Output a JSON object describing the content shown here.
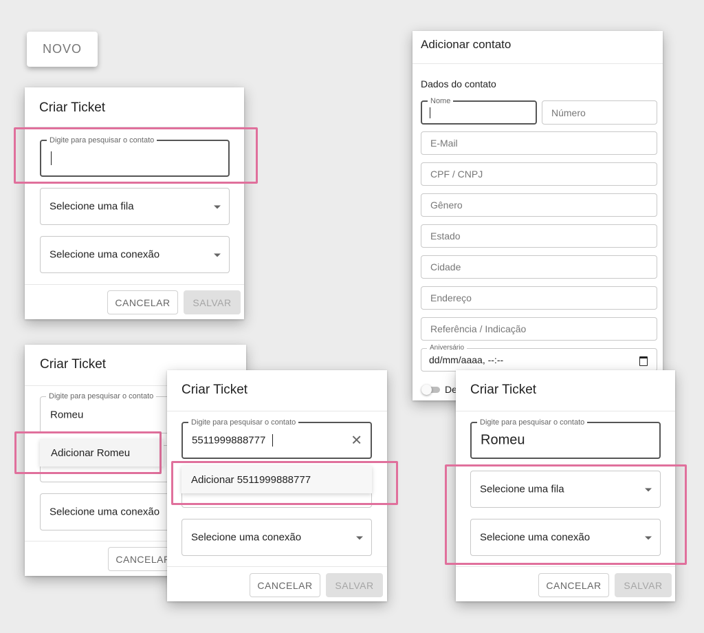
{
  "novo_button": "NOVO",
  "add_contact": {
    "title": "Adicionar contato",
    "section": "Dados do contato",
    "nome_label": "Nome",
    "numero": "Número",
    "email": "E-Mail",
    "cpf": "CPF / CNPJ",
    "genero": "Gênero",
    "estado": "Estado",
    "cidade": "Cidade",
    "endereco": "Endereço",
    "referencia": "Referência / Indicação",
    "aniversario_label": "Aniversário",
    "aniversario_value": "dd/mm/aaaa, --:--",
    "toggle_label": "De"
  },
  "ticket": {
    "title": "Criar Ticket",
    "search_label": "Digite para pesquisar o contato",
    "queue_placeholder": "Selecione uma fila",
    "connection_placeholder": "Selecione uma conexão",
    "cancel": "CANCELAR",
    "save": "SALVAR"
  },
  "ticket2": {
    "search_value": "Romeu",
    "option": "Adicionar Romeu"
  },
  "ticket3": {
    "search_value": "5511999888777",
    "option": "Adicionar 5511999888777"
  },
  "ticket4": {
    "search_value": "Romeu"
  },
  "colors": {
    "highlight": "#e0709c",
    "background": "#ececec"
  }
}
